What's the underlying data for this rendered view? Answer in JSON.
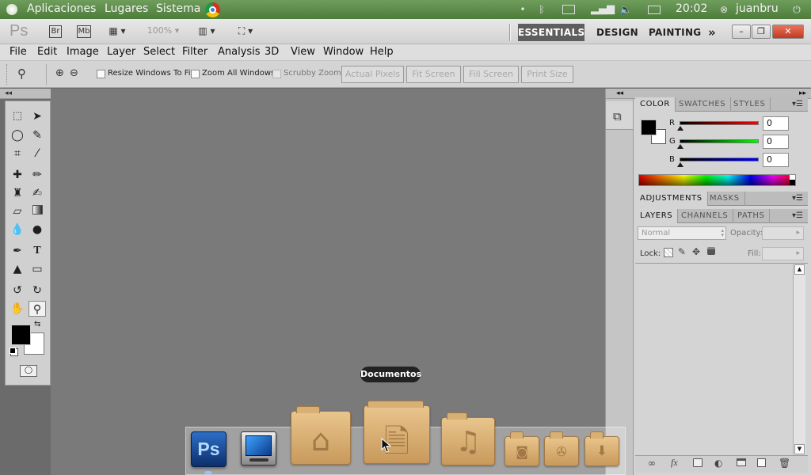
{
  "top_panel": {
    "menus": [
      "Aplicaciones",
      "Lugares",
      "Sistema"
    ],
    "clock": "20:02",
    "user": "juanbru"
  },
  "app_bar": {
    "logo": "Ps",
    "bridge": "Br",
    "minibridge": "Mb",
    "zoom": "100%",
    "workspaces": [
      "ESSENTIALS",
      "DESIGN",
      "PAINTING"
    ],
    "more": "»",
    "win_buttons": [
      "–",
      "❐",
      "✕"
    ]
  },
  "menu": [
    "File",
    "Edit",
    "Image",
    "Layer",
    "Select",
    "Filter",
    "Analysis",
    "3D",
    "View",
    "Window",
    "Help"
  ],
  "options": {
    "checkboxes": [
      "Resize Windows To Fit",
      "Zoom All Windows",
      "Scrubby Zoom"
    ],
    "buttons": [
      "Actual Pixels",
      "Fit Screen",
      "Fill Screen",
      "Print Size"
    ]
  },
  "collapse_arrows": "◂◂",
  "expand_arrows": "▸▸",
  "color_panel": {
    "tabs": [
      "COLOR",
      "SWATCHES",
      "STYLES"
    ],
    "sliders": [
      {
        "label": "R",
        "value": "0",
        "gradient": "#ff0000"
      },
      {
        "label": "G",
        "value": "0",
        "gradient": "#00ff00"
      },
      {
        "label": "B",
        "value": "0",
        "gradient": "#0000ff"
      }
    ]
  },
  "adjust_tabs": [
    "ADJUSTMENTS",
    "MASKS"
  ],
  "layers_panel": {
    "tabs": [
      "LAYERS",
      "CHANNELS",
      "PATHS"
    ],
    "blend_mode": "Normal",
    "opacity_label": "Opacity:",
    "lock_label": "Lock:",
    "fill_label": "Fill:"
  },
  "dock": {
    "tooltip": "Documentos"
  }
}
